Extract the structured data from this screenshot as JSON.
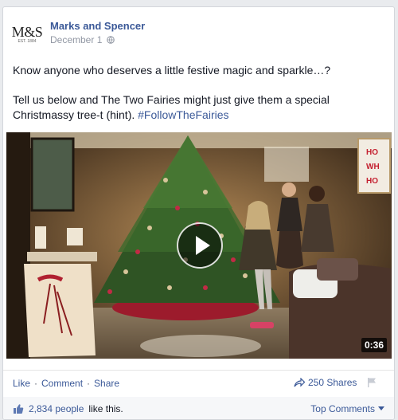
{
  "post": {
    "author": "Marks and Spencer",
    "logo": {
      "mark": "M&S",
      "tagline": "EST. 1884"
    },
    "date": "December 1",
    "privacy_icon": "globe-icon",
    "text": {
      "line1": "Know anyone who deserves a little festive magic and sparkle…?",
      "line2": "Tell us below and The Two Fairies might just give them a special Christmassy tree-t (hint).",
      "hashtag": "#FollowTheFairies"
    },
    "video": {
      "duration": "0:36",
      "play_icon": "play-icon",
      "frame": {
        "wall_sign": [
          "HO",
          "WH",
          "HO"
        ]
      }
    },
    "actions": {
      "like": "Like",
      "comment": "Comment",
      "share": "Share",
      "separator": "·",
      "shares_count": "250 Shares"
    },
    "likes": {
      "count": "2,834 people",
      "suffix": "like this.",
      "top_comments": "Top Comments",
      "dropdown_icon": "caret-down-icon"
    },
    "colors": {
      "link": "#3b5998",
      "text": "#141823",
      "muted": "#9197a3"
    }
  }
}
